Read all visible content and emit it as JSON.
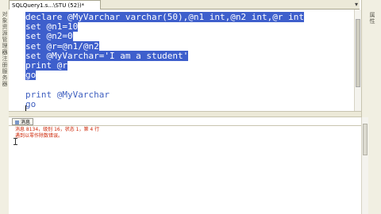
{
  "window": {
    "document_tab": "SQLQuery1.s...\\STU (52))*",
    "close_glyph": "×",
    "tab_arrow_glyph": "▾",
    "left_panel_labels": [
      "对象资源管理器",
      "已注册服务器"
    ],
    "right_panel_label": "属性"
  },
  "editor": {
    "lines": [
      {
        "text": "declare @MyVarchar varchar(50),@n1 int,@n2 int,@r int",
        "selected": true
      },
      {
        "text": "set @n1=10",
        "selected": true
      },
      {
        "text": "set @n2=0",
        "selected": true
      },
      {
        "text": "set @r=@n1/@n2",
        "selected": true
      },
      {
        "text": "set @MyVarchar='I am a student'",
        "selected": true
      },
      {
        "text": "print @r",
        "selected": true
      },
      {
        "text": "go",
        "selected": true
      },
      {
        "text": "",
        "selected": false
      },
      {
        "text": "print @MyVarchar",
        "selected": false
      },
      {
        "text": "go",
        "selected": false
      }
    ]
  },
  "results": {
    "tab_label": "消息",
    "messages": [
      "消息 8134，级别 16，状态 1，第 4 行",
      "遇到以零作除数错误。"
    ]
  },
  "colors": {
    "selection": "#3e5fcc",
    "message_text": "#cc2200",
    "code_text": "#4060c0"
  }
}
